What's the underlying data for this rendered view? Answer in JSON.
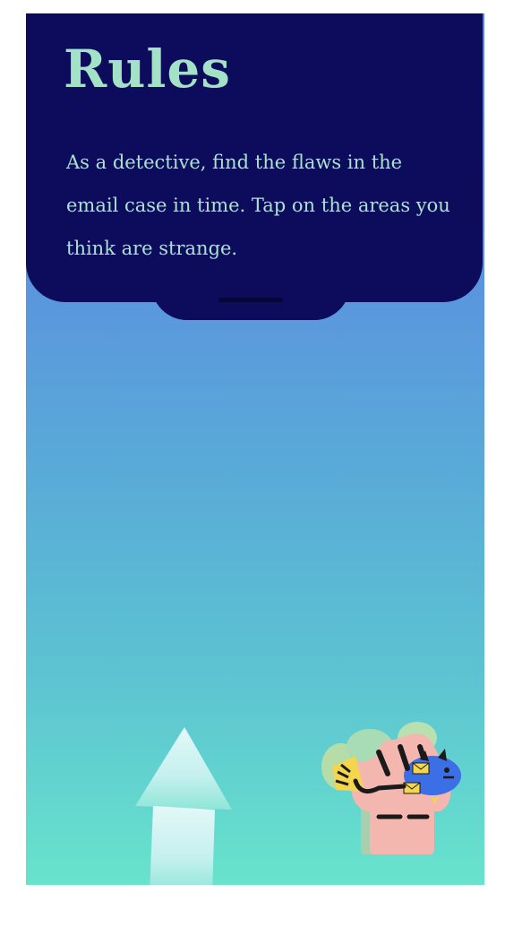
{
  "rules": {
    "title": "Rules",
    "description": "As a detective, find the flaws in the email case in time. Tap on the areas you think are strange."
  },
  "icons": {
    "drag_handle": "drag-handle",
    "swipe_hint": "up-arrow",
    "mascot": "fist-holding-phishing-fish"
  },
  "colors": {
    "panel": "#0d0b5b",
    "title": "#a3e2c6",
    "gradient_top": "#5b7fe6",
    "gradient_bottom": "#68e3cc"
  }
}
